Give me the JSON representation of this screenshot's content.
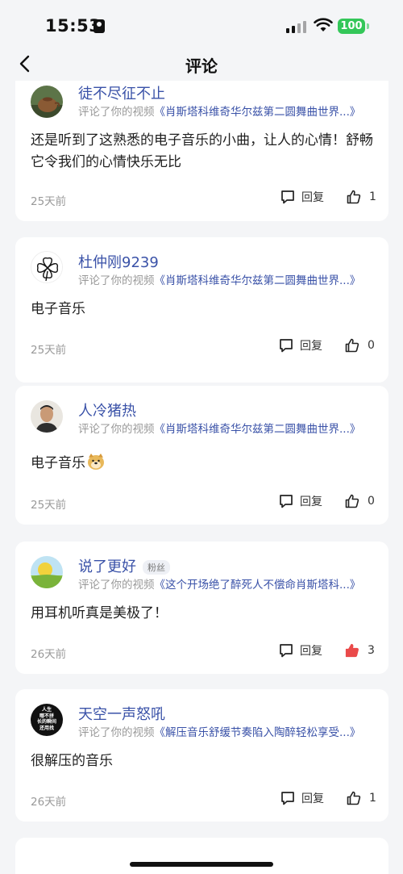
{
  "status": {
    "time": "15:53",
    "battery": "100"
  },
  "nav": {
    "title": "评论"
  },
  "labels": {
    "commented_prefix": "评论了你的视频",
    "reply": "回复"
  },
  "comments": [
    {
      "user": "徒不尽征不止",
      "video": "《肖斯塔科维奇华尔兹第二圆舞曲世界...》",
      "text": "还是听到了这熟悉的电子音乐的小曲，让人的心情！舒畅它令我们的心情快乐无比",
      "date": "25天前",
      "likes": "1",
      "liked": false
    },
    {
      "user": "杜仲刚9239",
      "video": "《肖斯塔科维奇华尔兹第二圆舞曲世界...》",
      "text": "电子音乐",
      "date": "25天前",
      "likes": "0",
      "liked": false
    },
    {
      "user": "人冷猪热",
      "video": "《肖斯塔科维奇华尔兹第二圆舞曲世界...》",
      "text": "电子音乐",
      "date": "25天前",
      "likes": "0",
      "liked": false
    },
    {
      "user": "说了更好",
      "badge": "粉丝",
      "video": "《这个开场绝了醉死人不偿命肖斯塔科...》",
      "text": "用耳机听真是美极了！",
      "date": "26天前",
      "likes": "3",
      "liked": true
    },
    {
      "user": "天空一声怒吼",
      "video": "《解压音乐舒缓节奏陷入陶醉轻松享受...》",
      "text": "很解压的音乐",
      "date": "26天前",
      "likes": "1",
      "liked": false
    }
  ],
  "avatar5_text": [
    "人生",
    "哪不拼",
    "长的瞬间",
    "还用找"
  ],
  "colors": {
    "link": "#3a52a8",
    "like_active": "#ea4a4a",
    "battery": "#34c759"
  },
  "icons": [
    "back-chevron-icon",
    "reply-bubble-icon",
    "thumbs-up-icon",
    "wifi-icon",
    "signal-icon",
    "id-card-icon"
  ]
}
